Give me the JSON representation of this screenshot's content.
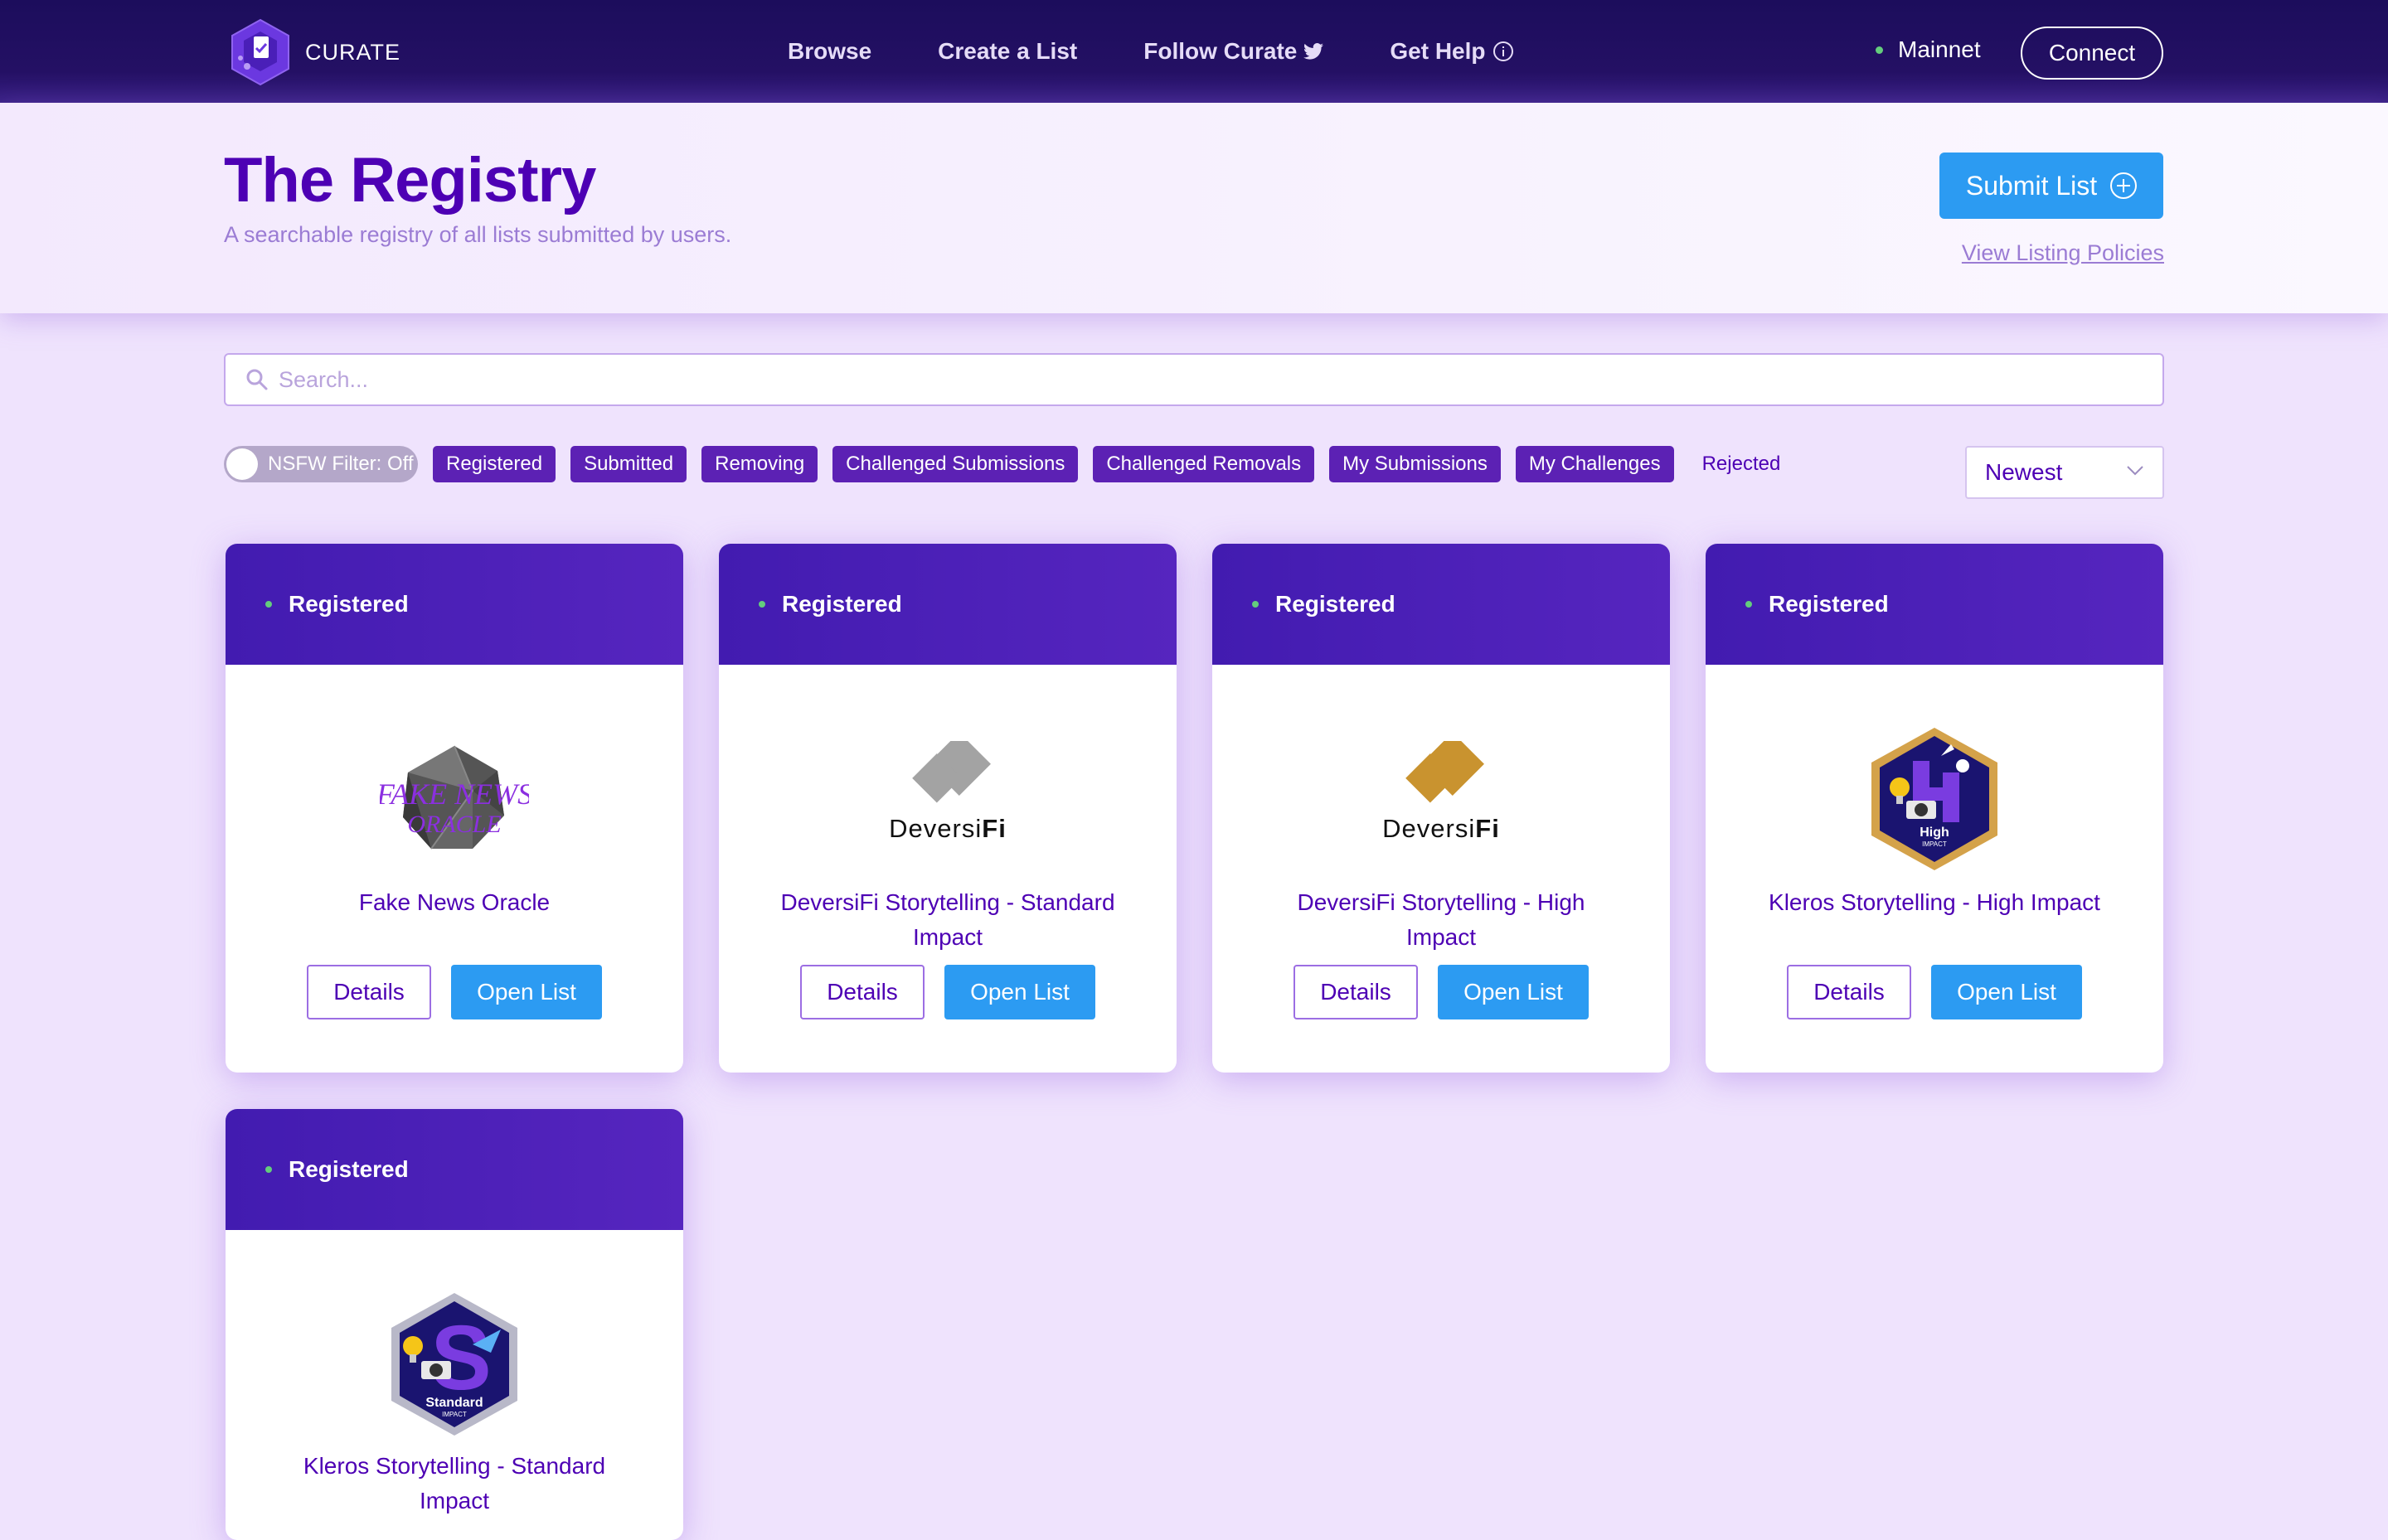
{
  "app": {
    "brand": "CURATE",
    "nav": [
      {
        "label": "Browse",
        "icon": ""
      },
      {
        "label": "Create a List",
        "icon": ""
      },
      {
        "label": "Follow Curate",
        "icon": "twitter-icon"
      },
      {
        "label": "Get Help",
        "icon": "info-icon"
      }
    ],
    "network": "Mainnet",
    "connect_label": "Connect"
  },
  "header": {
    "title": "The Registry",
    "subtitle": "A searchable registry of all lists submitted by users.",
    "submit_label": "Submit List",
    "policies_label": "View Listing Policies"
  },
  "search": {
    "placeholder": "Search...",
    "value": ""
  },
  "filters": {
    "nsfw_label": "NSFW Filter: Off",
    "chips": [
      "Registered",
      "Submitted",
      "Removing",
      "Challenged Submissions",
      "Challenged Removals",
      "My Submissions",
      "My Challenges"
    ],
    "plain": "Rejected",
    "sort": "Newest"
  },
  "cards": [
    {
      "status": "Registered",
      "title": "Fake News Oracle",
      "logo": "fake-news-oracle-logo",
      "details_label": "Details",
      "open_label": "Open List"
    },
    {
      "status": "Registered",
      "title": "DeversiFi Storytelling - Standard Impact",
      "logo": "deversifi-grey-logo",
      "logo_text_a": "Deversi",
      "logo_text_b": "Fi",
      "details_label": "Details",
      "open_label": "Open List"
    },
    {
      "status": "Registered",
      "title": "DeversiFi Storytelling - High Impact",
      "logo": "deversifi-gold-logo",
      "logo_text_a": "Deversi",
      "logo_text_b": "Fi",
      "details_label": "Details",
      "open_label": "Open List"
    },
    {
      "status": "Registered",
      "title": "Kleros Storytelling - High Impact",
      "logo": "kleros-high-impact-badge",
      "badge_a": "High",
      "badge_b": "IMPACT",
      "details_label": "Details",
      "open_label": "Open List"
    },
    {
      "status": "Registered",
      "title": "Kleros Storytelling - Standard Impact",
      "logo": "kleros-standard-impact-badge",
      "badge_a": "Standard",
      "badge_b": "IMPACT",
      "details_label": "Details",
      "open_label": "Open List"
    }
  ],
  "colors": {
    "primary": "#4d00b4",
    "nav_bg": "#1c0d5c",
    "button_blue": "#2c9bf2",
    "chip_bg": "#5c21b4",
    "status_dot": "#64cd7d",
    "page_bg": "#efe3fd"
  }
}
